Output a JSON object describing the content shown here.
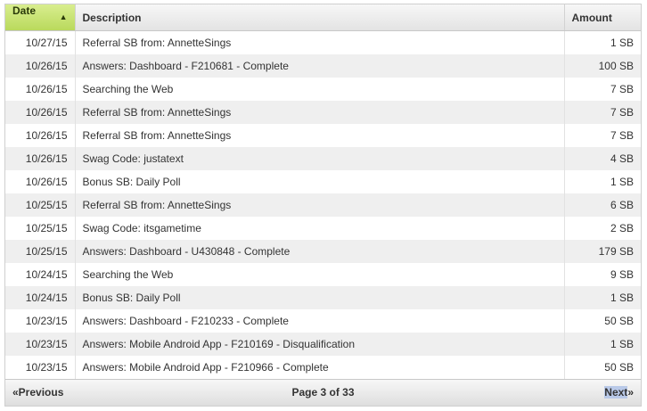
{
  "table": {
    "columns": {
      "date": "Date",
      "description": "Description",
      "amount": "Amount"
    },
    "sort_indicator": "▲",
    "rows": [
      {
        "date": "10/27/15",
        "description": "Referral SB from: AnnetteSings",
        "amount": "1 SB"
      },
      {
        "date": "10/26/15",
        "description": "Answers: Dashboard - F210681 - Complete",
        "amount": "100 SB"
      },
      {
        "date": "10/26/15",
        "description": "Searching the Web",
        "amount": "7 SB"
      },
      {
        "date": "10/26/15",
        "description": "Referral SB from: AnnetteSings",
        "amount": "7 SB"
      },
      {
        "date": "10/26/15",
        "description": "Referral SB from: AnnetteSings",
        "amount": "7 SB"
      },
      {
        "date": "10/26/15",
        "description": "Swag Code: justatext",
        "amount": "4 SB"
      },
      {
        "date": "10/26/15",
        "description": "Bonus SB: Daily Poll",
        "amount": "1 SB"
      },
      {
        "date": "10/25/15",
        "description": "Referral SB from: AnnetteSings",
        "amount": "6 SB"
      },
      {
        "date": "10/25/15",
        "description": "Swag Code: itsgametime",
        "amount": "2 SB"
      },
      {
        "date": "10/25/15",
        "description": "Answers: Dashboard - U430848 - Complete",
        "amount": "179 SB"
      },
      {
        "date": "10/24/15",
        "description": "Searching the Web",
        "amount": "9 SB"
      },
      {
        "date": "10/24/15",
        "description": "Bonus SB: Daily Poll",
        "amount": "1 SB"
      },
      {
        "date": "10/23/15",
        "description": "Answers: Dashboard - F210233 - Complete",
        "amount": "50 SB"
      },
      {
        "date": "10/23/15",
        "description": "Answers: Mobile Android App - F210169 - Disqualification",
        "amount": "1 SB"
      },
      {
        "date": "10/23/15",
        "description": "Answers: Mobile Android App - F210966 - Complete",
        "amount": "50 SB"
      }
    ]
  },
  "pager": {
    "prev_label": "«Previous",
    "page_info": "Page 3 of 33",
    "next_label": "Next",
    "next_arrow": "»"
  }
}
